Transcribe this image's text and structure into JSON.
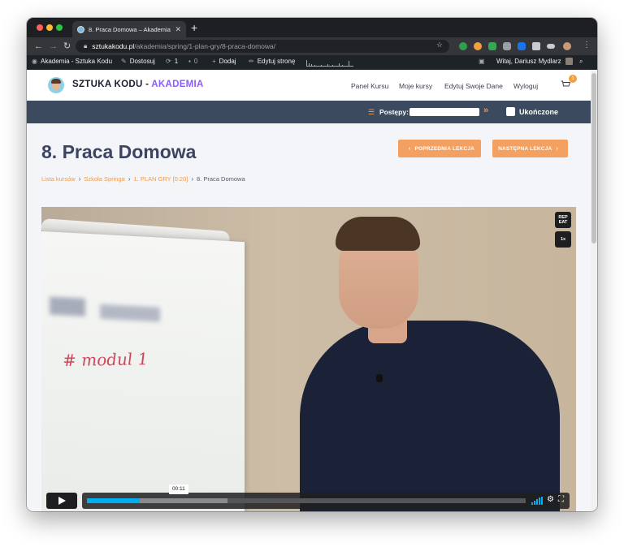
{
  "browser": {
    "tab": {
      "title": "8. Praca Domowa – Akademia"
    },
    "url": {
      "host": "sztukakodu.pl",
      "path": "/akademia/spring/1-plan-gry/8-praca-domowa/"
    }
  },
  "adminbar": {
    "site": "Akademia - Sztuka Kodu",
    "customize": "Dostosuj",
    "updates": "1",
    "comments": "0",
    "add": "Dodaj",
    "edit": "Edytuj stronę",
    "greeting": "Witaj, Dariusz Mydlarz"
  },
  "header": {
    "brand": "SZTUKA KODU",
    "brand_sep": " - ",
    "brand_accent": "AKADEMIA",
    "nav": [
      "Panel Kursu",
      "Moje kursy",
      "Edytuj Swoje Dane",
      "Wyloguj"
    ],
    "cart_count": "1"
  },
  "progress": {
    "label": "Postępy:",
    "arrows": "»",
    "complete_label": "Ukończone",
    "value": 0
  },
  "lesson": {
    "title": "8. Praca Domowa",
    "prev_button": "POPRZEDNIA LEKCJA",
    "next_button": "NASTĘPNA LEKCJA",
    "breadcrumb": [
      "Lista kursów",
      "Szkoła Springa",
      "1. PLAN GRY [0:20]",
      "8. Praca Domowa"
    ]
  },
  "video": {
    "board_text": "# modul 1",
    "repeat_label": "REP EAT",
    "speed_label": "1x",
    "current_time": "00:11",
    "played_fraction": 0.12,
    "buffered_fraction": 0.32
  },
  "colors": {
    "accent_orange": "#f4a060",
    "brand_purple": "#8b5cf6",
    "progress_strip": "#3b4a5e",
    "player_blue": "#00adef"
  }
}
